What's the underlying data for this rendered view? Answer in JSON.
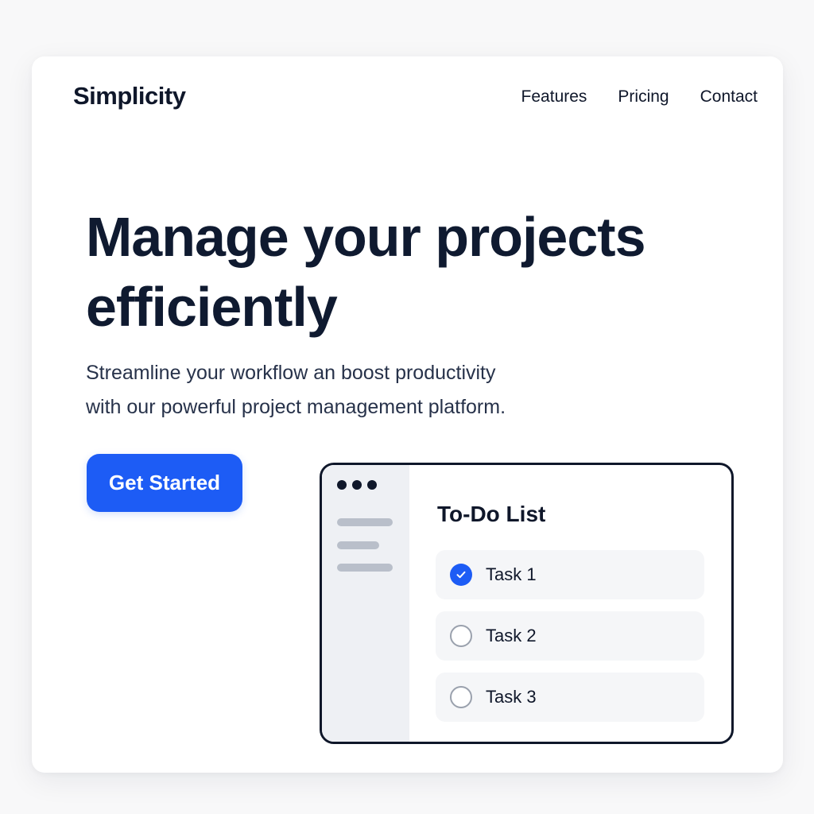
{
  "brand": {
    "name": "Simplicity"
  },
  "nav": {
    "items": [
      "Features",
      "Pricing",
      "Contact"
    ]
  },
  "hero": {
    "title_line1": "Manage your projects",
    "title_line2": "efficiently",
    "subtitle_line1": "Streamline your workflow an boost productivity",
    "subtitle_line2": "with our powerful project management platform.",
    "cta_label": "Get Started"
  },
  "mockup": {
    "title": "To-Do List",
    "tasks": [
      {
        "label": "Task 1",
        "done": true
      },
      {
        "label": "Task 2",
        "done": false
      },
      {
        "label": "Task 3",
        "done": false
      }
    ]
  },
  "colors": {
    "accent": "#1d5cf5",
    "text": "#0f172a",
    "sidebar": "#eef0f4"
  }
}
